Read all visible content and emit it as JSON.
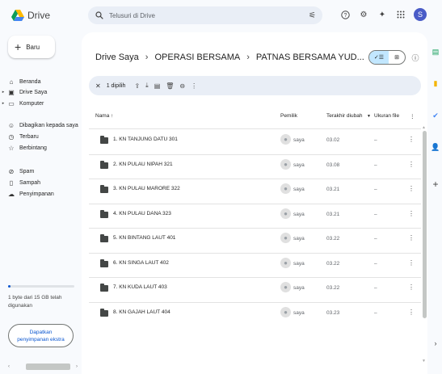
{
  "app": {
    "title": "Drive"
  },
  "search": {
    "placeholder": "Telusuri di Drive"
  },
  "topbar": {
    "avatar_letter": "S"
  },
  "new_button": {
    "label": "Baru"
  },
  "sidebar": {
    "items": [
      {
        "label": "Beranda",
        "icon": "home-icon"
      },
      {
        "label": "Drive Saya",
        "icon": "my-drive-icon",
        "expandable": true
      },
      {
        "label": "Komputer",
        "icon": "computer-icon",
        "expandable": true
      },
      {
        "label": "Dibagikan kepada saya",
        "icon": "shared-icon"
      },
      {
        "label": "Terbaru",
        "icon": "clock-icon"
      },
      {
        "label": "Berbintang",
        "icon": "star-icon"
      },
      {
        "label": "Spam",
        "icon": "spam-icon"
      },
      {
        "label": "Sampah",
        "icon": "trash-icon"
      },
      {
        "label": "Penyimpanan",
        "icon": "cloud-icon"
      }
    ],
    "storage_text": "1 byte dari 15 GB telah digunakan",
    "storage_fraction": 0.04,
    "get_storage_label": "Dapatkan penyimpanan ekstra"
  },
  "breadcrumb": {
    "root": "Drive Saya",
    "parent": "OPERASI BERSAMA",
    "current": "PATNAS BERSAMA YUD..."
  },
  "selection_bar": {
    "count_label": "1 dipilih"
  },
  "table": {
    "headers": {
      "name": "Nama",
      "owner": "Pemilik",
      "modified": "Terakhir diubah",
      "size": "Ukuran file"
    },
    "rows": [
      {
        "name": "1. KN TANJUNG DATU 301",
        "owner": "saya",
        "modified": "03.02",
        "size": "–"
      },
      {
        "name": "2. KN PULAU NIPAH 321",
        "owner": "saya",
        "modified": "03.08",
        "size": "–"
      },
      {
        "name": "3. KN PULAU MARORE 322",
        "owner": "saya",
        "modified": "03.21",
        "size": "–"
      },
      {
        "name": "4. KN PULAU DANA 323",
        "owner": "saya",
        "modified": "03.21",
        "size": "–"
      },
      {
        "name": "5. KN BINTANG LAUT 401",
        "owner": "saya",
        "modified": "03.22",
        "size": "–"
      },
      {
        "name": "6. KN SINGA LAUT 402",
        "owner": "saya",
        "modified": "03.22",
        "size": "–"
      },
      {
        "name": "7. KN KUDA LAUT 403",
        "owner": "saya",
        "modified": "03.22",
        "size": "–"
      },
      {
        "name": "8. KN GAJAH LAUT 404",
        "owner": "saya",
        "modified": "03.23",
        "size": "–"
      }
    ]
  },
  "colors": {
    "accent": "#0b57d0",
    "selected_view": "#c2e7ff",
    "avatar": "#4a5cc7"
  }
}
